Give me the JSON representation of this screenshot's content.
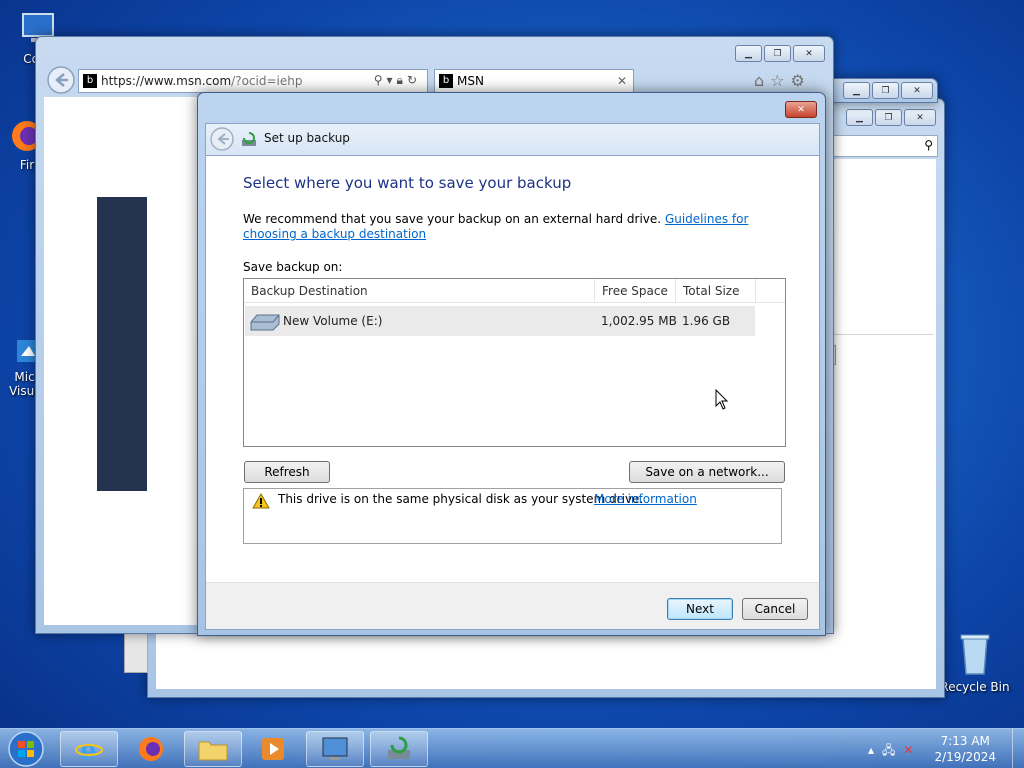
{
  "desktop": {
    "icons": [
      {
        "label": "Com",
        "name": "computer"
      },
      {
        "label": "Fir",
        "name": "firefox"
      },
      {
        "label": "Micr Visual",
        "name": "visual-studio"
      },
      {
        "label": "Recycle Bin",
        "name": "recycle-bin"
      }
    ]
  },
  "ie": {
    "url_main": "https://www.msn.com",
    "url_dim": "/?ocid=iehp",
    "tab_label": "MSN"
  },
  "dialog": {
    "title": "Set up backup",
    "heading": "Select where you want to save your backup",
    "recommend_text": "We recommend that you save your backup on an external hard drive.",
    "guidelines_link": "Guidelines for choosing a backup destination",
    "save_on_label": "Save backup on:",
    "columns": [
      "Backup Destination",
      "Free Space",
      "Total Size"
    ],
    "rows": [
      {
        "destination": "New Volume (E:)",
        "free_space": "1,002.95 MB",
        "total_size": "1.96 GB"
      }
    ],
    "refresh_button": "Refresh",
    "network_button": "Save on a network...",
    "warning_text": "This drive is on the same physical disk as your system drive.",
    "more_info_link": "More information",
    "next_button": "Next",
    "cancel_button": "Cancel"
  },
  "taskbar": {
    "time": "7:13 AM",
    "date": "2/19/2024"
  }
}
